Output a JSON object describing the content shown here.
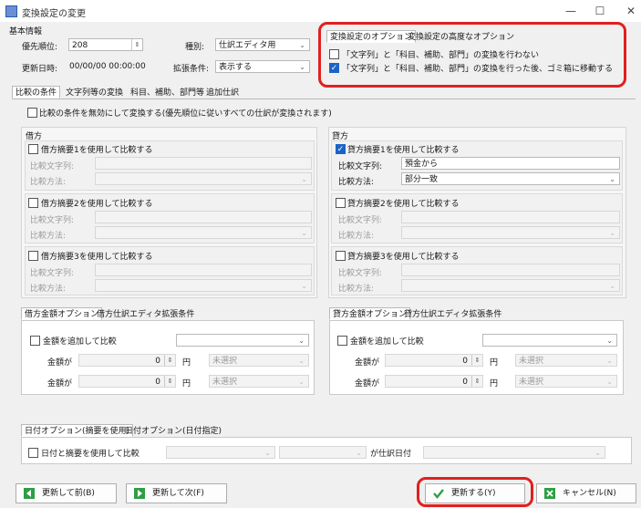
{
  "window": {
    "title": "変換設定の変更",
    "minimize": "—",
    "maximize": "☐",
    "close": "✕"
  },
  "basic": {
    "group_label": "基本情報",
    "priority_label": "優先順位:",
    "priority_value": "208",
    "updated_label": "更新日時:",
    "updated_value": "00/00/00 00:00:00",
    "type_label": "種別:",
    "type_value": "仕訳エディタ用",
    "ext_label": "拡張条件:",
    "ext_value": "表示する"
  },
  "options": {
    "tab1": "変換設定のオプション",
    "tab2": "変換設定の高度なオプション",
    "opt1": "「文字列」と「科目、補助、部門」の変換を行わない",
    "opt2": "「文字列」と「科目、補助、部門」の変換を行った後、ゴミ箱に移動する"
  },
  "main_tabs": [
    "比較の条件",
    "文字列等の変換",
    "科目、補助、部門等",
    "追加仕訳"
  ],
  "disable_compare": "比較の条件を無効にして変換する(優先順位に従いすべての仕訳が変換されます)",
  "debit": {
    "label": "借方",
    "s1": "借方摘要1を使用して比較する",
    "s2": "借方摘要2を使用して比較する",
    "s3": "借方摘要3を使用して比較する",
    "str_label": "比較文字列:",
    "method_label": "比較方法:",
    "tab1": "借方金額オプション",
    "tab2": "借方仕訳エディタ拡張条件",
    "amount_cb": "金額を追加して比較",
    "amount_label": "金額が",
    "amount_val": "0",
    "yen": "円",
    "unselected": "未選択"
  },
  "credit": {
    "label": "貸方",
    "s1": "貸方摘要1を使用して比較する",
    "s1_str": "預金から",
    "s1_method": "部分一致",
    "s2": "貸方摘要2を使用して比較する",
    "s3": "貸方摘要3を使用して比較する",
    "str_label": "比較文字列:",
    "method_label": "比較方法:",
    "tab1": "貸方金額オプション",
    "tab2": "貸方仕訳エディタ拡張条件",
    "amount_cb": "金額を追加して比較",
    "amount_label": "金額が",
    "amount_val": "0",
    "yen": "円",
    "unselected": "未選択"
  },
  "date": {
    "tab1": "日付オプション(摘要を使用)",
    "tab2": "日付オプション(日付指定)",
    "cb": "日付と摘要を使用して比較",
    "suffix": "が仕訳日付"
  },
  "buttons": {
    "prev": "更新して前(B)",
    "next": "更新して次(F)",
    "ok": "更新する(Y)",
    "cancel": "キャンセル(N)"
  },
  "colors": {
    "accent": "#1c63c7",
    "highlight": "#e02020",
    "ok_green": "#2f9e44"
  }
}
